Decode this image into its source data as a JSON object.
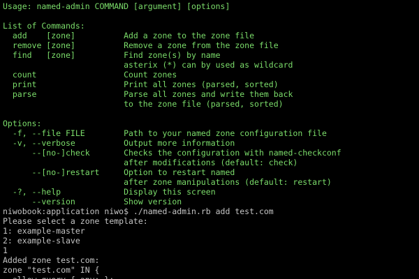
{
  "terminal": {
    "colors": {
      "background": "#000000",
      "help_text": "#7bdc6a",
      "output_text": "#c4c4c4"
    },
    "lines": [
      {
        "type": "usage",
        "text": "Usage: named-admin COMMAND [argument] [options]"
      },
      {
        "type": "blank",
        "text": ""
      },
      {
        "type": "usage",
        "text": "List of Commands:"
      },
      {
        "type": "cmd",
        "text": "  add    [zone]          Add a zone to the zone file"
      },
      {
        "type": "cmd",
        "text": "  remove [zone]          Remove a zone from the zone file"
      },
      {
        "type": "cmd",
        "text": "  find   [zone]          Find zone(s) by name"
      },
      {
        "type": "cmd",
        "text": "                         asterix (*) can by used as wildcard"
      },
      {
        "type": "cmd",
        "text": "  count                  Count zones"
      },
      {
        "type": "cmd",
        "text": "  print                  Print all zones (parsed, sorted)"
      },
      {
        "type": "cmd",
        "text": "  parse                  Parse all zones and write them back"
      },
      {
        "type": "cmd",
        "text": "                         to the zone file (parsed, sorted)"
      },
      {
        "type": "blank",
        "text": ""
      },
      {
        "type": "usage",
        "text": "Options:"
      },
      {
        "type": "opt",
        "text": "  -f, --file FILE        Path to your named zone configuration file"
      },
      {
        "type": "opt",
        "text": "  -v, --verbose          Output more information"
      },
      {
        "type": "opt",
        "text": "      --[no-]check       Checks the configuration with named-checkconf"
      },
      {
        "type": "opt",
        "text": "                         after modifications (default: check)"
      },
      {
        "type": "opt",
        "text": "      --[no-]restart     Option to restart named"
      },
      {
        "type": "opt",
        "text": "                         after zone manipulations (default: restart)"
      },
      {
        "type": "opt",
        "text": "  -?, --help             Display this screen"
      },
      {
        "type": "opt",
        "text": "      --version          Show version"
      },
      {
        "type": "prompt",
        "text": "niwobook:application niwo$ ./named-admin.rb add test.com"
      },
      {
        "type": "output",
        "text": "Please select a zone template:"
      },
      {
        "type": "output",
        "text": "1: example-master"
      },
      {
        "type": "output",
        "text": "2: example-slave"
      },
      {
        "type": "output",
        "text": "1"
      },
      {
        "type": "output",
        "text": "Added zone test.com:"
      },
      {
        "type": "output",
        "text": "zone \"test.com\" IN {"
      },
      {
        "type": "output",
        "text": "  allow-query { any; };"
      }
    ]
  }
}
